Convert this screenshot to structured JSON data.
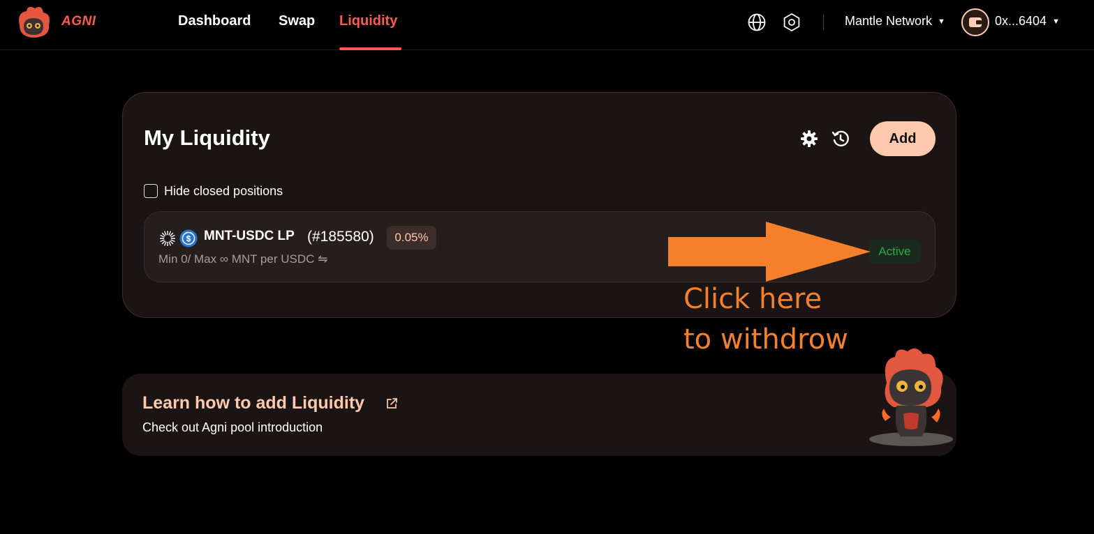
{
  "header": {
    "brand": "AGNI",
    "nav": [
      {
        "label": "Dashboard"
      },
      {
        "label": "Swap"
      },
      {
        "label": "Liquidity",
        "active": true
      }
    ],
    "network": "Mantle Network",
    "wallet_address": "0x...6404",
    "icons": [
      "globe-icon",
      "settings-hex-icon",
      "wallet-icon",
      "chevron-down-icon"
    ]
  },
  "liquidity": {
    "title": "My Liquidity",
    "add_label": "Add",
    "hide_closed_label": "Hide closed positions",
    "hide_closed_checked": false,
    "icons": [
      "gear-icon",
      "history-icon"
    ],
    "positions": [
      {
        "pair": "MNT-USDC LP",
        "id": "(#185580)",
        "fee": "0.05%",
        "range": "Min 0/ Max ∞ MNT per USDC ⇋",
        "status": "Active",
        "tokens": [
          "mnt-token-icon",
          "usdc-token-icon"
        ]
      }
    ]
  },
  "annotation": {
    "line1": "Click here",
    "line2": "to withdrow",
    "color": "#f5802b"
  },
  "learn": {
    "title": "Learn how to add Liquidity",
    "subtitle": "Check out Agni pool introduction"
  },
  "colors": {
    "accent": "#ff5a4e",
    "peach": "#ffc9ae",
    "active_green": "#2ea84a",
    "background": "#000000",
    "card": "#1a1514"
  }
}
